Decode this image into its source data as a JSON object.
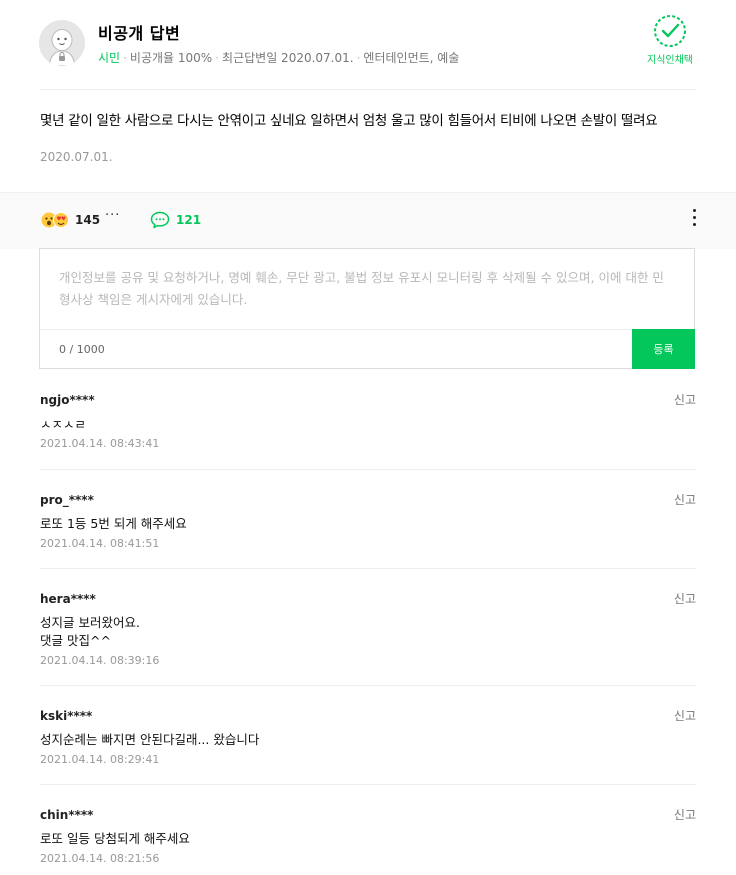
{
  "answer": {
    "author": "비공개 답변",
    "grade": "시민",
    "meta": [
      "비공개율 100%",
      "최근답변일 2020.07.01.",
      "엔터테인먼트, 예술"
    ],
    "adopted_label": "지식인채택",
    "text": "몇년 같이 일한 사람으로 다시는 안엮이고 싶네요 일하면서 엄청 울고 많이 힘들어서 티비에 나오면 손발이 떨려요",
    "date": "2020.07.01."
  },
  "reactions": {
    "like_count": "145",
    "more": "···",
    "comment_count": "121"
  },
  "comment_form": {
    "placeholder": "개인정보를 공유 및 요청하거나, 명예 훼손, 무단 광고, 불법 정보 유포시 모니터링 후 삭제될 수 있으며, 이에 대한 민형사상 책임은 게시자에게 있습니다.",
    "char_count": "0 / 1000",
    "submit_label": "등록"
  },
  "comments": [
    {
      "user": "ngjo****",
      "text": "ㅅㅈㅅㄹ",
      "date": "2021.04.14. 08:43:41",
      "report": "신고"
    },
    {
      "user": "pro_****",
      "text": "로또 1등 5번 되게 해주세요",
      "date": "2021.04.14. 08:41:51",
      "report": "신고"
    },
    {
      "user": "hera****",
      "text": "성지글 보러왔어요.\n댓글 맛집^^",
      "date": "2021.04.14. 08:39:16",
      "report": "신고"
    },
    {
      "user": "kski****",
      "text": "성지순례는 빠지면 안된다길래... 왔습니다",
      "date": "2021.04.14. 08:29:41",
      "report": "신고"
    },
    {
      "user": "chin****",
      "text": "로또 일등 당첨되게 해주세요",
      "date": "2021.04.14. 08:21:56",
      "report": "신고"
    }
  ],
  "colors": {
    "accent": "#03c75a",
    "meta": "#777777",
    "date": "#999999"
  }
}
